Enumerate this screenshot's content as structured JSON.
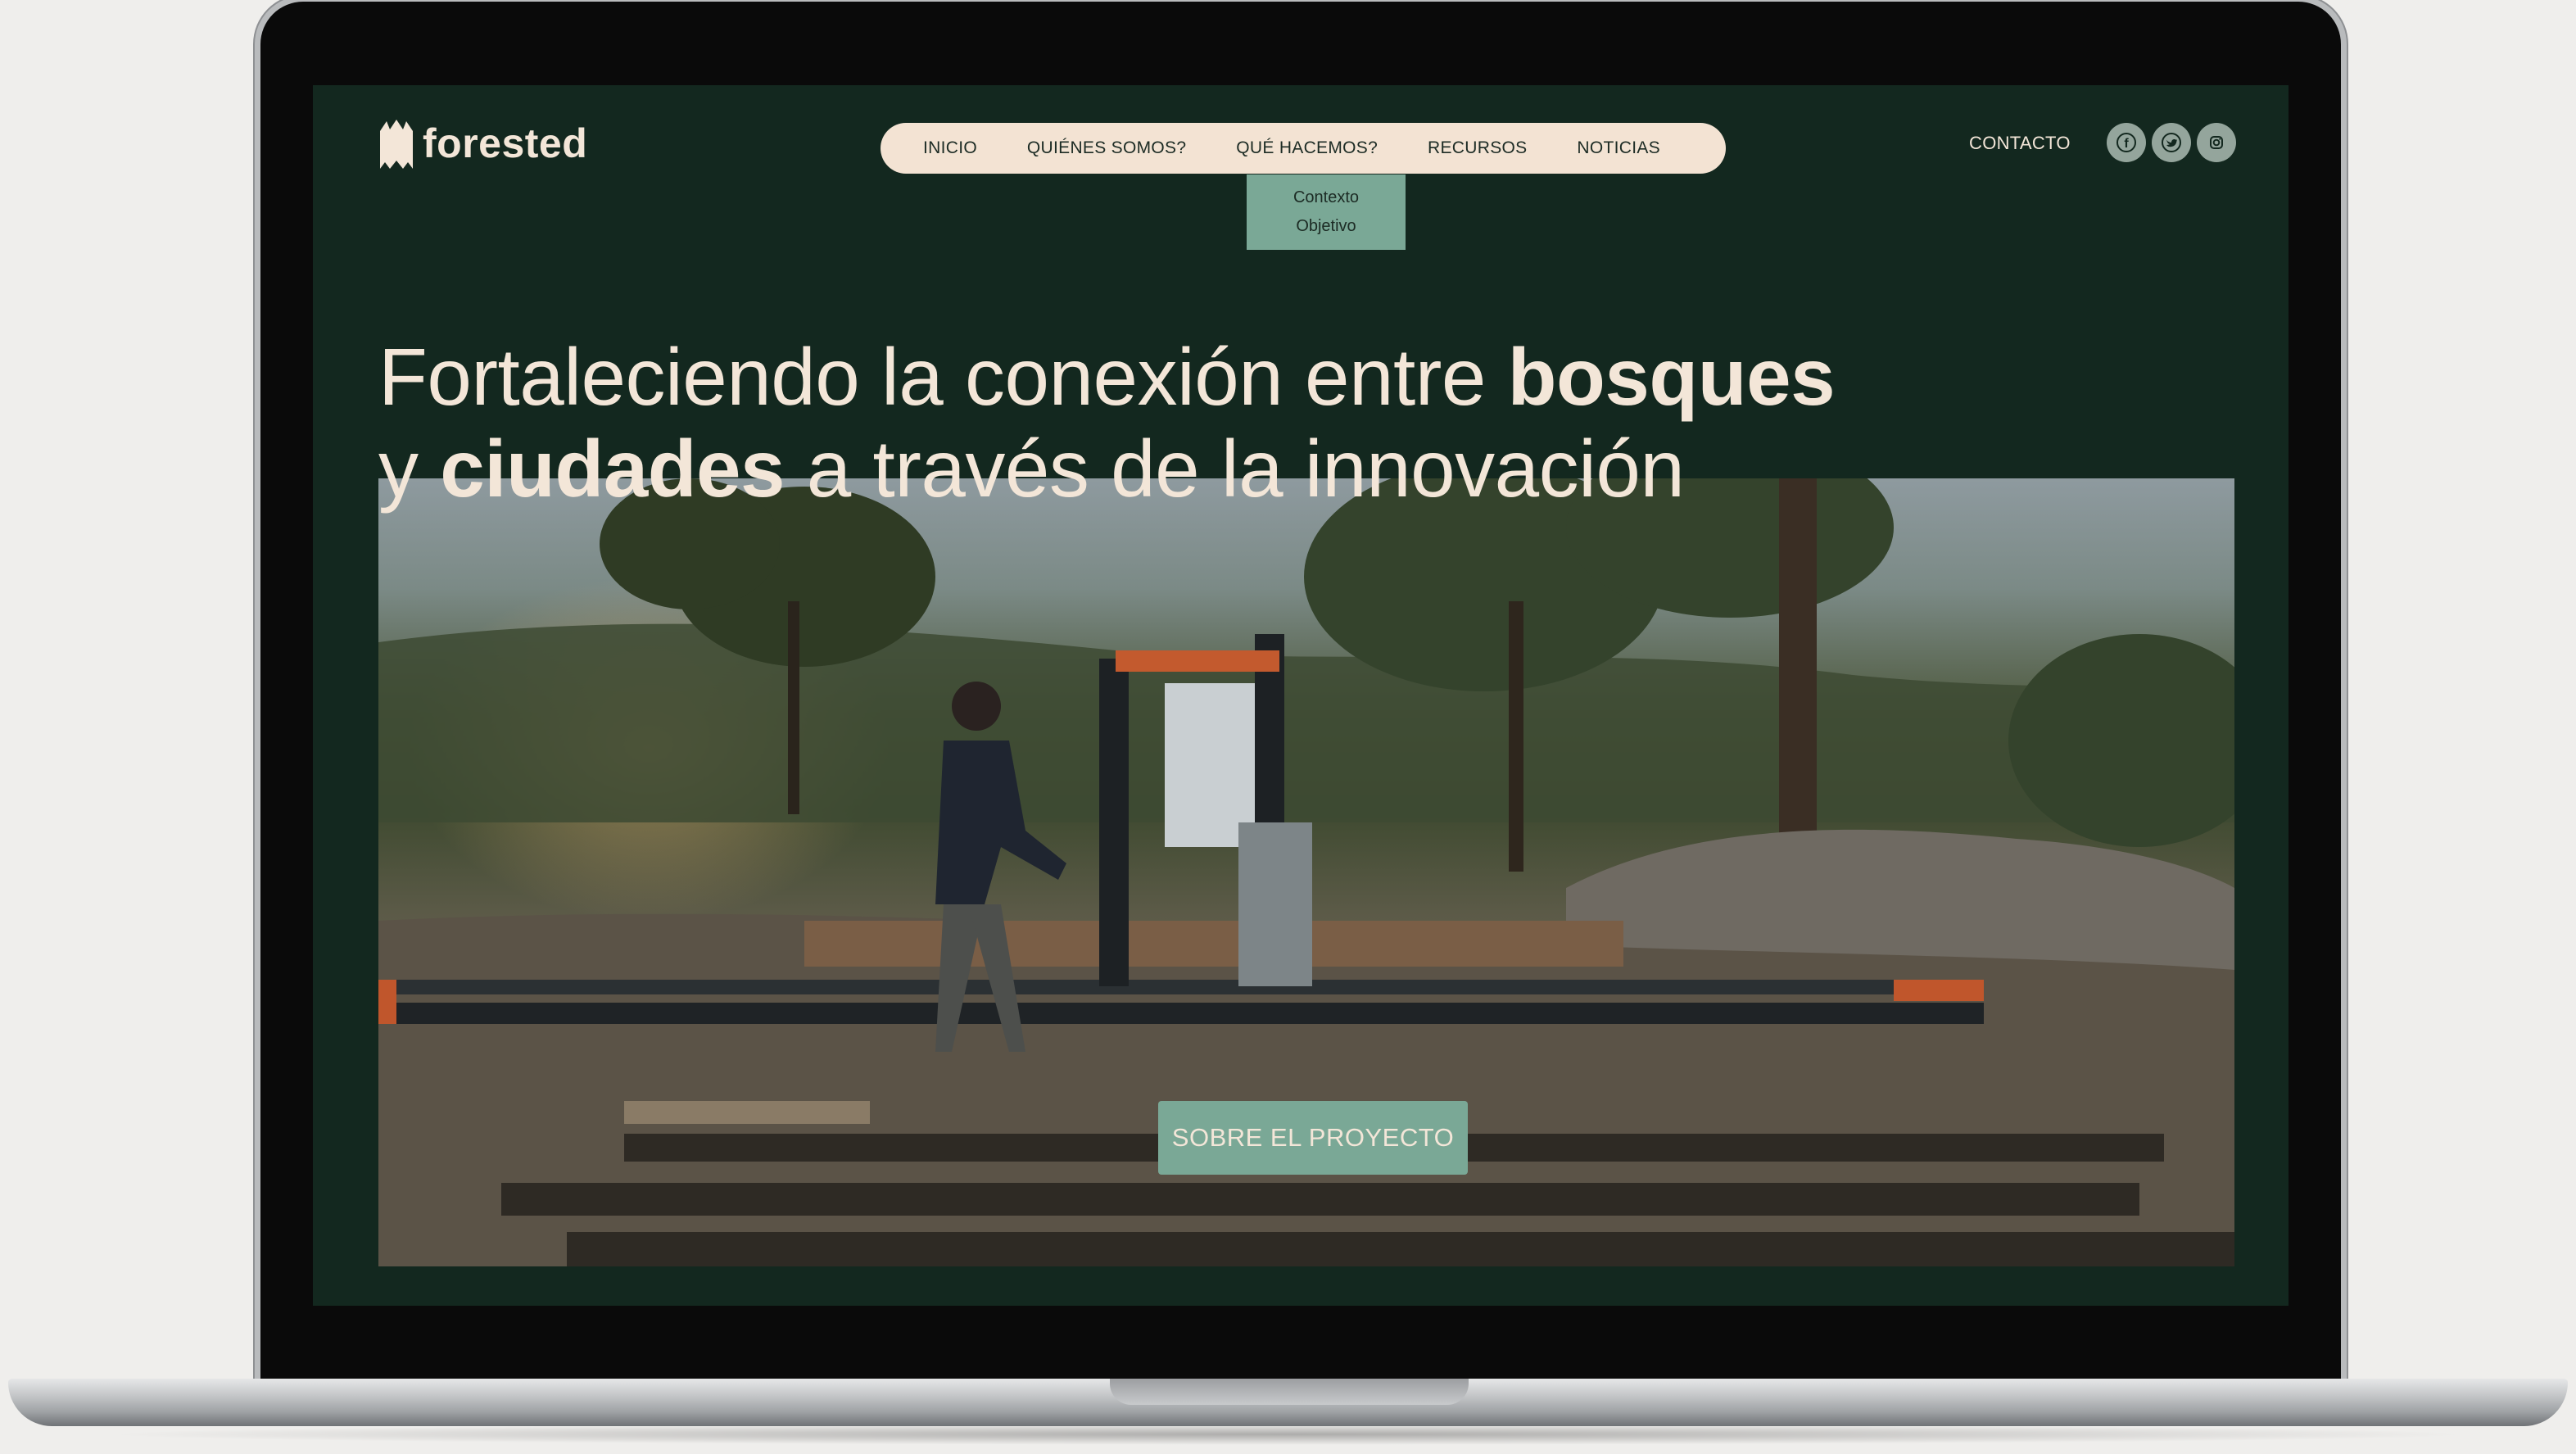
{
  "brand": {
    "name": "forested"
  },
  "nav": {
    "items": [
      {
        "label": "INICIO"
      },
      {
        "label": "QUIÉNES SOMOS?"
      },
      {
        "label": "QUÉ HACEMOS?"
      },
      {
        "label": "RECURSOS"
      },
      {
        "label": "NOTICIAS"
      }
    ],
    "dropdown": [
      "Contexto",
      "Objetivo"
    ]
  },
  "header": {
    "contact_label": "CONTACTO",
    "social": [
      {
        "icon": "facebook-icon",
        "glyph": "f"
      },
      {
        "icon": "twitter-icon"
      },
      {
        "icon": "instagram-icon"
      }
    ]
  },
  "hero": {
    "line1_a": "Fortaleciendo la conexión entre ",
    "line1_b": "bosques",
    "line2_a": "y ",
    "line2_b": "ciudades",
    "line2_c": " a través de la innovación",
    "cta_label": "SOBRE EL PROYECTO"
  },
  "colors": {
    "background": "#13281f",
    "nav_pill": "#f3e3d3",
    "accent": "#7aa896",
    "text_light": "#f3e6d8"
  }
}
